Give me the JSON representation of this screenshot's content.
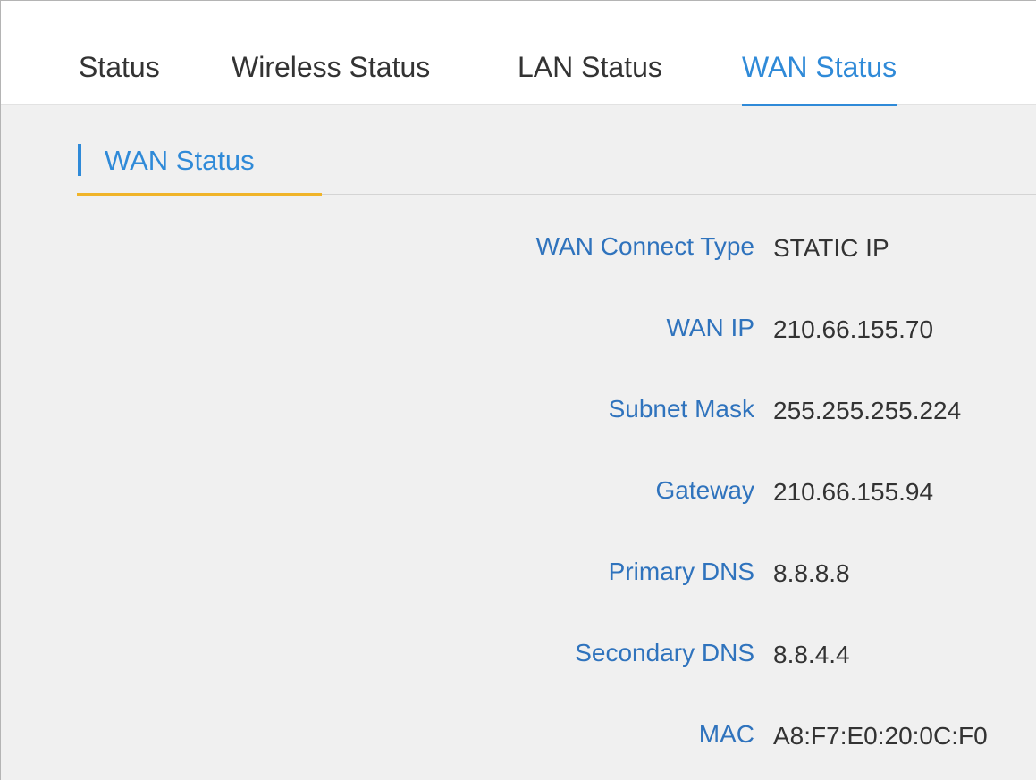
{
  "tabs": {
    "status": "Status",
    "wireless": "Wireless Status",
    "lan": "LAN Status",
    "wan": "WAN Status",
    "active": "wan"
  },
  "section": {
    "title": "WAN Status"
  },
  "wan_info": {
    "connect_type": {
      "label": "WAN Connect Type",
      "value": "STATIC IP"
    },
    "ip": {
      "label": "WAN IP",
      "value": "210.66.155.70"
    },
    "subnet": {
      "label": "Subnet Mask",
      "value": "255.255.255.224"
    },
    "gateway": {
      "label": "Gateway",
      "value": "210.66.155.94"
    },
    "primary_dns": {
      "label": "Primary DNS",
      "value": "8.8.8.8"
    },
    "secondary_dns": {
      "label": "Secondary DNS",
      "value": "8.8.4.4"
    },
    "mac": {
      "label": "MAC",
      "value": "A8:F7:E0:20:0C:F0"
    }
  },
  "colors": {
    "accent": "#2f8ad8",
    "label": "#2f73bd",
    "underline": "#f0b429",
    "background": "#f0f0f0"
  }
}
